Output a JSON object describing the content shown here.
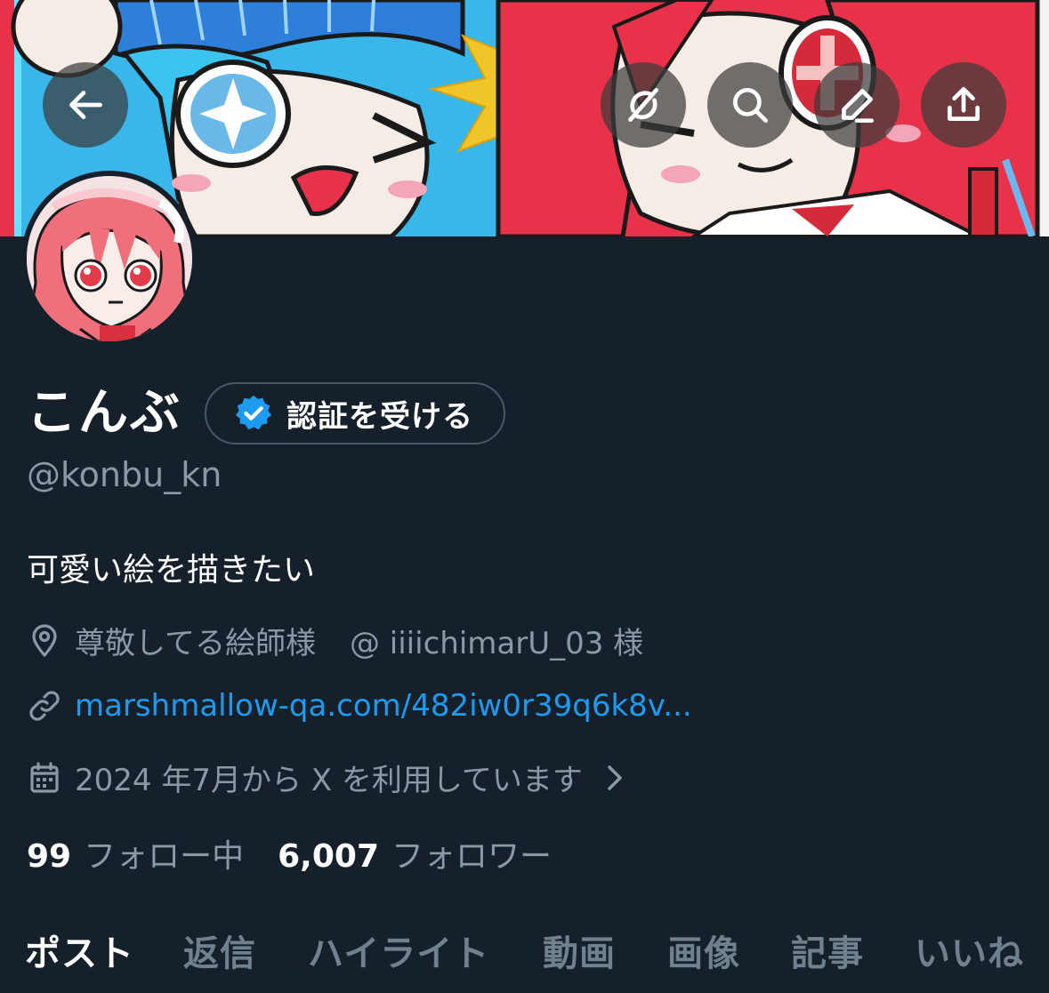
{
  "profile": {
    "display_name": "こんぶ",
    "verify_label": "認証を受ける",
    "handle": "@konbu_kn",
    "bio": "可愛い絵を描きたい",
    "location": "尊敬してる絵師様",
    "location_mention": "@ iiiichimarU_03 様",
    "link": "marshmallow-qa.com/482iw0r39q6k8v...",
    "joined": "2024 年7月から X を利用しています",
    "following_count": "99",
    "following_label": "フォロー中",
    "followers_count": "6,007",
    "followers_label": "フォロワー"
  },
  "tabs": [
    {
      "label": "ポスト",
      "active": true
    },
    {
      "label": "返信",
      "active": false
    },
    {
      "label": "ハイライト",
      "active": false
    },
    {
      "label": "動画",
      "active": false
    },
    {
      "label": "画像",
      "active": false
    },
    {
      "label": "記事",
      "active": false
    },
    {
      "label": "いいね",
      "active": false
    }
  ],
  "header_buttons": [
    "back-arrow-icon",
    "grok-icon",
    "search-icon",
    "edit-icon",
    "share-icon"
  ],
  "colors": {
    "background": "#15202b",
    "text_primary": "#ffffff",
    "text_secondary": "#8b98a5",
    "link": "#1d9bf0",
    "verified_badge": "#1d9bf0"
  }
}
